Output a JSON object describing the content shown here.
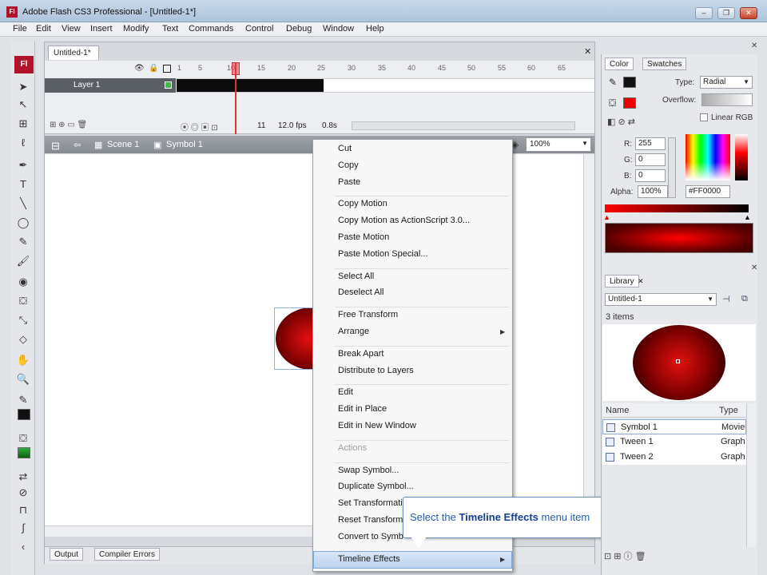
{
  "window": {
    "app_icon": "Fl",
    "title": "Adobe Flash CS3 Professional - [Untitled-1*]"
  },
  "menubar": [
    "File",
    "Edit",
    "View",
    "Insert",
    "Modify",
    "Text",
    "Commands",
    "Control",
    "Debug",
    "Window",
    "Help"
  ],
  "document": {
    "tab": "Untitled-1*",
    "layer_name": "Layer 1",
    "frame_numbers": [
      "1",
      "5",
      "10",
      "15",
      "20",
      "25",
      "30",
      "35",
      "40",
      "45",
      "50",
      "55",
      "60",
      "65"
    ],
    "current_frame": "11",
    "fps": "12.0 fps",
    "time": "0.8s",
    "scene": "Scene 1",
    "symbol": "Symbol 1",
    "zoom": "100%"
  },
  "context_menu": {
    "groups": [
      [
        {
          "label": "Cut"
        },
        {
          "label": "Copy"
        },
        {
          "label": "Paste"
        }
      ],
      [
        {
          "label": "Copy Motion"
        },
        {
          "label": "Copy Motion as ActionScript 3.0..."
        },
        {
          "label": "Paste Motion"
        },
        {
          "label": "Paste Motion Special..."
        }
      ],
      [
        {
          "label": "Select All"
        },
        {
          "label": "Deselect All"
        }
      ],
      [
        {
          "label": "Free Transform"
        },
        {
          "label": "Arrange",
          "submenu": true
        }
      ],
      [
        {
          "label": "Break Apart"
        },
        {
          "label": "Distribute to Layers"
        }
      ],
      [
        {
          "label": "Edit"
        },
        {
          "label": "Edit in Place"
        },
        {
          "label": "Edit in New Window"
        }
      ],
      [
        {
          "label": "Actions",
          "disabled": true
        }
      ],
      [
        {
          "label": "Swap Symbol..."
        },
        {
          "label": "Duplicate Symbol..."
        },
        {
          "label": "Set Transformati"
        },
        {
          "label": "Reset Transform"
        },
        {
          "label": "Convert to Symb"
        },
        {
          "label": "Timeline Effects",
          "submenu": true,
          "highlighted": true
        }
      ]
    ]
  },
  "tooltip": {
    "prefix": "Select the ",
    "bold": "Timeline Effects",
    "suffix": " menu item"
  },
  "bottom_tabs": [
    "Output",
    "Compiler Errors"
  ],
  "color_panel": {
    "tabs": [
      "Color",
      "Swatches"
    ],
    "type_label": "Type:",
    "type_value": "Radial",
    "overflow_label": "Overflow:",
    "linear_rgb_label": "Linear RGB",
    "r_label": "R:",
    "r_value": "255",
    "g_label": "G:",
    "g_value": "0",
    "b_label": "B:",
    "b_value": "0",
    "alpha_label": "Alpha:",
    "alpha_value": "100%",
    "hex_value": "#FF0000"
  },
  "library_panel": {
    "tab": "Library",
    "document_select": "Untitled-1",
    "item_count": "3 items",
    "col_name": "Name",
    "col_type": "Type",
    "items": [
      {
        "name": "Symbol 1",
        "type": "Movie"
      },
      {
        "name": "Tween 1",
        "type": "Graph"
      },
      {
        "name": "Tween 2",
        "type": "Graph"
      }
    ]
  },
  "colors": {
    "flash_red": "#b3132a",
    "fill_red": "#ff0000",
    "tooltip_blue": "#2a5db0",
    "highlight": "#bcd3ee"
  }
}
